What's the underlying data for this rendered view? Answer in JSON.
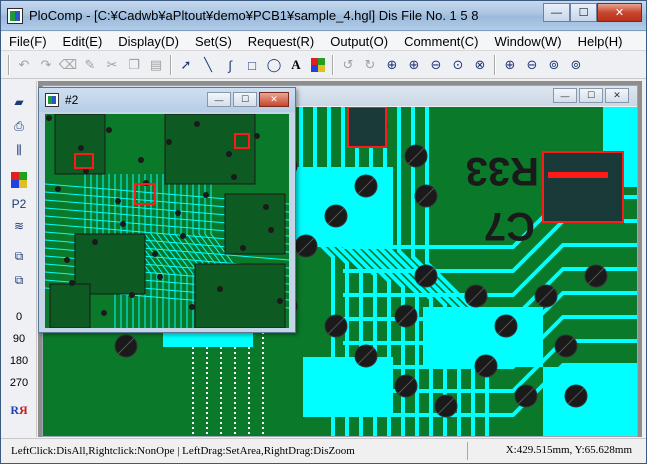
{
  "window": {
    "title": "PloComp - [C:¥Cadwb¥aPltout¥demo¥PCB1¥sample_4.hgl] Dis File No. 1 5 8",
    "minimize": "—",
    "maximize": "☐",
    "close": "✕"
  },
  "menu": [
    "File(F)",
    "Edit(E)",
    "Display(D)",
    "Set(S)",
    "Request(R)",
    "Output(O)",
    "Comment(C)",
    "Window(W)",
    "Help(H)"
  ],
  "toolbar": {
    "icons": [
      "undo-icon",
      "redo-icon",
      "eraser-icon",
      "pen-icon",
      "cut-icon",
      "copy-icon",
      "paste-icon",
      "pointer-icon",
      "line-icon",
      "curve-icon",
      "rectangle-icon",
      "ellipse-icon",
      "text-icon",
      "color-palette-icon",
      "undo-view-icon",
      "redo-view-icon",
      "zoom-area-icon",
      "zoom-in-icon",
      "zoom-out-icon",
      "zoom-fit-icon",
      "zoom-reset-icon",
      "zoom-plus-icon",
      "zoom-minus-icon",
      "zoom-up-icon",
      "zoom-down-icon"
    ],
    "text_tool": "A"
  },
  "left_toolbar": {
    "layer_label": "P2",
    "angles": [
      "0",
      "90",
      "180",
      "270"
    ]
  },
  "child2": {
    "title": "#2",
    "minimize": "—",
    "maximize": "☐",
    "close": "✕"
  },
  "pcb_labels": [
    "R33",
    "C7"
  ],
  "colors": {
    "board": "#0a7a2a",
    "traces": "#00ffff",
    "pads": "#1a1a1a",
    "highlight": "#ff1a1a"
  },
  "status": {
    "left": "LeftClick:DisAll,Rightclick:NonOpe  |  LeftDrag:SetArea,RightDrag:DisZoom",
    "coords": "X:429.515mm, Y:65.628mm"
  }
}
